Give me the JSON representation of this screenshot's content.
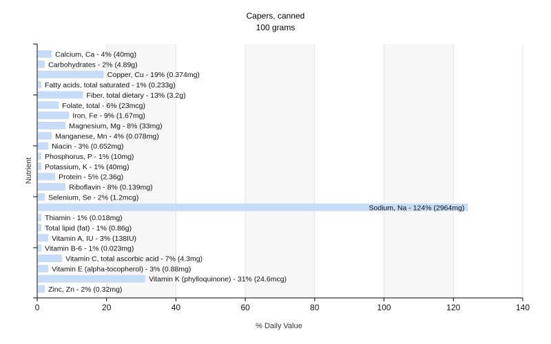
{
  "chart_data": {
    "type": "bar",
    "orientation": "horizontal",
    "title": "Capers, canned",
    "subtitle": "100 grams",
    "xlabel": "% Daily Value",
    "ylabel": "Nutrient",
    "xlim": [
      0,
      140
    ],
    "xticks": [
      0,
      20,
      40,
      60,
      80,
      100,
      120,
      140
    ],
    "grid": true,
    "bar_color": "#c6dcf7",
    "categories": [
      "Calcium, Ca - 4% (40mg)",
      "Carbohydrates - 2% (4.89g)",
      "Copper, Cu - 19% (0.374mg)",
      "Fatty acids, total saturated - 1% (0.233g)",
      "Fiber, total dietary - 13% (3.2g)",
      "Folate, total - 6% (23mcg)",
      "Iron, Fe - 9% (1.67mg)",
      "Magnesium, Mg - 8% (33mg)",
      "Manganese, Mn - 4% (0.078mg)",
      "Niacin - 3% (0.652mg)",
      "Phosphorus, P - 1% (10mg)",
      "Potassium, K - 1% (40mg)",
      "Protein - 5% (2.36g)",
      "Riboflavin - 8% (0.139mg)",
      "Selenium, Se - 2% (1.2mcg)",
      "Sodium, Na - 124% (2964mg)",
      "Thiamin - 1% (0.018mg)",
      "Total lipid (fat) - 1% (0.86g)",
      "Vitamin A, IU - 3% (138IU)",
      "Vitamin B-6 - 1% (0.023mg)",
      "Vitamin C, total ascorbic acid - 7% (4.3mg)",
      "Vitamin E (alpha-tocopherol) - 3% (0.88mg)",
      "Vitamin K (phylloquinone) - 31% (24.6mcg)",
      "Zinc, Zn - 2% (0.32mg)"
    ],
    "values": [
      4,
      2,
      19,
      1,
      13,
      6,
      9,
      8,
      4,
      3,
      1,
      1,
      5,
      8,
      2,
      124,
      1,
      1,
      3,
      1,
      7,
      3,
      31,
      2
    ]
  }
}
